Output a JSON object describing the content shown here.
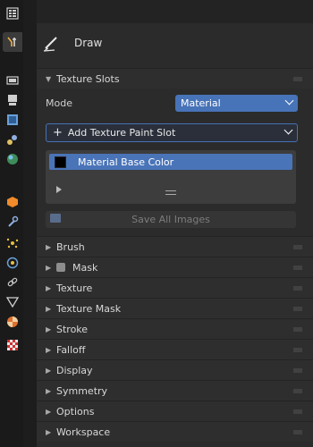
{
  "header": {
    "tool_label": "Draw"
  },
  "texture_slots": {
    "title": "Texture Slots",
    "mode_label": "Mode",
    "mode_value": "Material",
    "add_slot_label": "Add Texture Paint Slot",
    "slots": [
      {
        "name": "Material Base Color",
        "color": "#000000"
      }
    ],
    "save_all_label": "Save All Images"
  },
  "panels": [
    {
      "id": "brush",
      "label": "Brush"
    },
    {
      "id": "mask",
      "label": "Mask"
    },
    {
      "id": "texture",
      "label": "Texture"
    },
    {
      "id": "texture-mask",
      "label": "Texture Mask"
    },
    {
      "id": "stroke",
      "label": "Stroke"
    },
    {
      "id": "falloff",
      "label": "Falloff"
    },
    {
      "id": "display",
      "label": "Display"
    },
    {
      "id": "symmetry",
      "label": "Symmetry"
    },
    {
      "id": "options",
      "label": "Options"
    },
    {
      "id": "workspace",
      "label": "Workspace"
    }
  ],
  "colors": {
    "accent": "#4773b8",
    "panel_bg": "#2b2b2b"
  }
}
